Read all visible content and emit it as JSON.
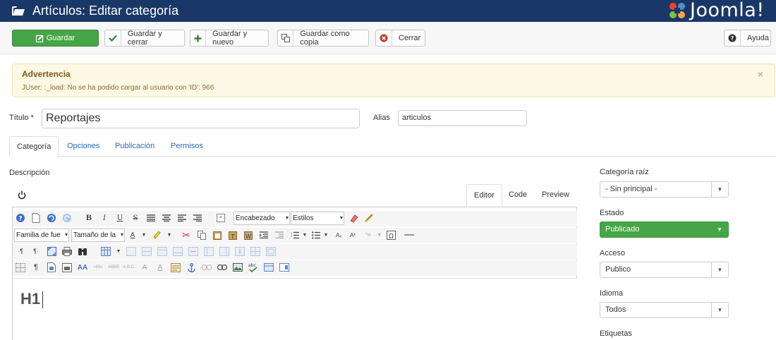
{
  "header": {
    "title": "Artículos: Editar categoría",
    "logo_text": "Joomla!"
  },
  "toolbar": {
    "save": "Guardar",
    "save_close": "Guardar y cerrar",
    "save_new": "Guardar y nuevo",
    "save_copy": "Guardar como copia",
    "close": "Cerrar",
    "help": "Ayuda"
  },
  "alert": {
    "heading": "Advertencia",
    "message": "JUser: :_load: No se ha podido cargar al usuario con 'ID': 966",
    "close": "×"
  },
  "form": {
    "title_label": "Título *",
    "title_value": "Reportajes",
    "alias_label": "Alias",
    "alias_value": "articulos"
  },
  "tabs": [
    "Categoría",
    "Opciones",
    "Publicación",
    "Permisos"
  ],
  "editor": {
    "description_label": "Descripción",
    "tabs": [
      "Editor",
      "Code",
      "Preview"
    ],
    "heading_select": "Encabezado",
    "styles_select": "Estilos",
    "font_family": "Familia de fue",
    "font_size": "Tamaño de la",
    "content_text": "H1"
  },
  "sidebar": {
    "parent_label": "Categoría raíz",
    "parent_value": "- Sin principal -",
    "status_label": "Estado",
    "status_value": "Publicado",
    "access_label": "Acceso",
    "access_value": "Publico",
    "language_label": "Idioma",
    "language_value": "Todos",
    "tags_label": "Etiquetas"
  },
  "colors": {
    "header_bg": "#1a3867",
    "save_green": "#46a546",
    "link_blue": "#2a69b8",
    "alert_bg": "#fcf8e3"
  }
}
